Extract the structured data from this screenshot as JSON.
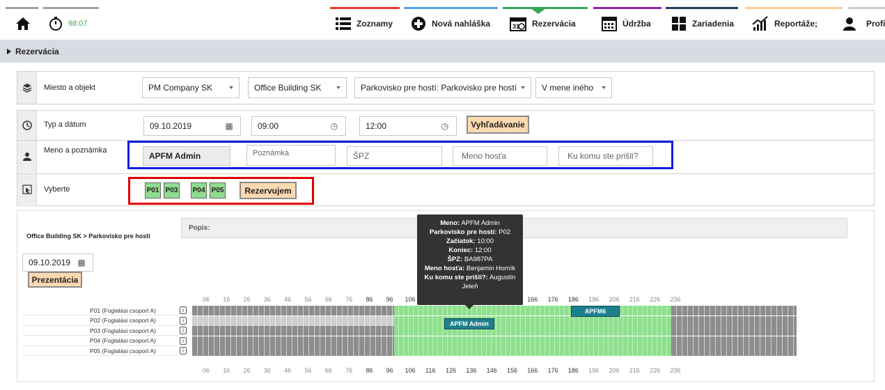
{
  "nav": {
    "timer": "98:07",
    "items": [
      {
        "label": "Zoznamy",
        "icon": "list-icon"
      },
      {
        "label": "Nová nahláška",
        "icon": "plus-circle-icon"
      },
      {
        "label": "Rezervácia",
        "icon": "calendar-icon"
      },
      {
        "label": "Údržba",
        "icon": "calendar-grid-icon"
      },
      {
        "label": "Zariadenia",
        "icon": "tiles-icon"
      },
      {
        "label": "Reportáže;",
        "icon": "chart-icon"
      },
      {
        "label": "Profil",
        "icon": "user-icon"
      }
    ],
    "stripe_colors": [
      "#9e9e9e",
      "#9e9e9e",
      "#e53935",
      "#58a6e8",
      "#35a853",
      "#8e24aa",
      "#263b5e",
      "#ffcc99"
    ]
  },
  "section": {
    "title": "Rezervácia"
  },
  "filters": {
    "place_label": "Miesto a objekt",
    "company": "PM Company SK",
    "building": "Office Building SK",
    "parking": "Parkovisko pre hostí: Parkovisko pre hostí",
    "on_behalf": "V mene iného",
    "type_label": "Typ a dátum",
    "date": "09.10.2019",
    "time_from": "09:00",
    "time_to": "12:00",
    "search_button": "Vyhľadávanie",
    "name_label": "Meno a poznámka",
    "name_value": "APFM Admin",
    "note_placeholder": "Poznámka",
    "plate_placeholder": "ŠPZ",
    "guest_placeholder": "Meno hosťa",
    "visiting_placeholder": "Ku komu ste prišli?",
    "select_label": "Vyberte",
    "spots": [
      "P01",
      "P03",
      "P04",
      "P05"
    ],
    "reserve_button": "Rezervujem"
  },
  "gantt": {
    "breadcrumb": "Office Building SK > Parkovisko pre hostí",
    "description_label": "Popis:",
    "date": "09.10.2019",
    "presentation_button": "Prezentácia",
    "ticks": [
      "06",
      "16",
      "26",
      "36",
      "46",
      "56",
      "66",
      "76",
      "86",
      "96",
      "106",
      "116",
      "126",
      "136",
      "146",
      "156",
      "166",
      "176",
      "186",
      "196",
      "206",
      "216",
      "226",
      "236"
    ],
    "rows": [
      {
        "label": "P01 (Foglalási csoport A)"
      },
      {
        "label": "P02 (Foglalási csoport A)"
      },
      {
        "label": "P03 (Foglalási csoport A)"
      },
      {
        "label": "P04 (Foglalási csoport A)"
      },
      {
        "label": "P05 (Foglalási csoport A)"
      }
    ],
    "reservations": [
      {
        "row": "P01 (Foglalási csoport A)",
        "label": "APFM6"
      },
      {
        "row": "P02 (Foglalási csoport A)",
        "label": "APFM Admin"
      }
    ]
  },
  "tooltip": {
    "name_key": "Meno:",
    "name_val": "APFM Admin",
    "parking_key": "Parkovisko pre hostí:",
    "parking_val": "P02",
    "start_key": "Začiatok:",
    "start_val": "10:00",
    "end_key": "Koniec:",
    "end_val": "12:00",
    "plate_key": "ŠPZ:",
    "plate_val": "BA987PA",
    "guest_key": "Meno hosťa:",
    "guest_val": "Benjamin Horník",
    "visit_key": "Ku komu ste prišli?:",
    "visit_val": "Augustín Jeleň"
  }
}
